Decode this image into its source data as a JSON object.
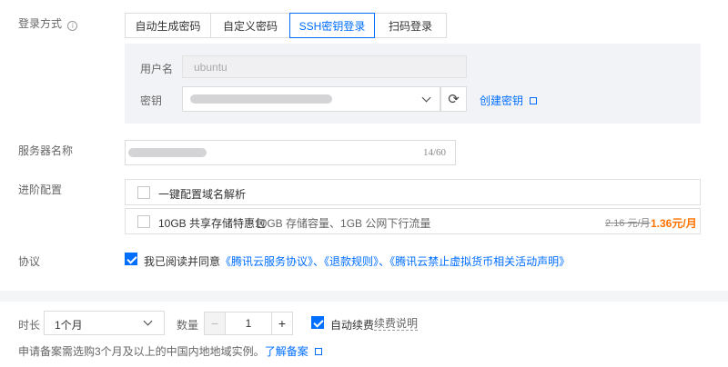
{
  "login": {
    "label": "登录方式",
    "info_icon": "info-circle-icon",
    "tabs": [
      {
        "label": "自动生成密码",
        "active": false
      },
      {
        "label": "自定义密码",
        "active": false
      },
      {
        "label": "SSH密钥登录",
        "active": true
      },
      {
        "label": "扫码登录",
        "active": false
      }
    ],
    "username_label": "用户名",
    "username_value": "ubuntu",
    "key_label": "密钥",
    "create_key_link": "创建密钥"
  },
  "server_name": {
    "label": "服务器名称",
    "counter": "14/60"
  },
  "advanced": {
    "label": "进阶配置",
    "domain_option": "一键配置域名解析",
    "storage_option": "10GB 共享存储特惠包",
    "storage_desc": "10GB 存储容量、1GB 公网下行流量",
    "old_price": "2.16 元/月",
    "new_price": "1.36元/月"
  },
  "agreement": {
    "label": "协议",
    "text_prefix": "我已阅读并同意",
    "link1": "《腾讯云服务协议》",
    "sep1": "、",
    "link2": "《退款规则》",
    "sep2": "、",
    "link3": "《腾讯云禁止虚拟货币相关活动声明》"
  },
  "footer": {
    "duration_label": "时长",
    "duration_value": "1个月",
    "quantity_label": "数量",
    "quantity_value": "1",
    "minus": "−",
    "plus": "+",
    "auto_renew_label": "自动续费",
    "renew_info_link": "续费说明",
    "note": "申请备案需选购3个月及以上的中国内地地域实例。",
    "learn_link": "了解备案"
  },
  "colors": {
    "accent": "#006eff",
    "price_orange": "#ff7200",
    "panel_bg": "#f2f3f6"
  }
}
